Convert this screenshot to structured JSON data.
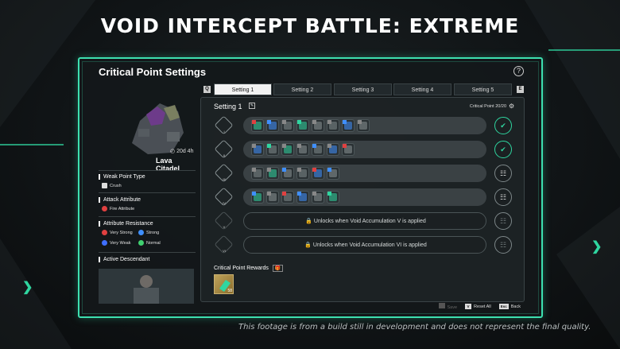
{
  "headline": "VOID INTERCEPT BATTLE: EXTREME",
  "panel": {
    "title": "Critical Point Settings",
    "help": "?"
  },
  "boss": {
    "timer": "20d 4h",
    "name": "Lava Citadel"
  },
  "weak_point": {
    "heading": "Weak Point Type",
    "value": "Crush"
  },
  "attack_attribute": {
    "heading": "Attack Attribute",
    "value": "Fire Attribute"
  },
  "resistance": {
    "heading": "Attribute Resistance",
    "items": [
      {
        "label": "Very Strong",
        "color": "#e04040"
      },
      {
        "label": "Strong",
        "color": "#3f8fff"
      },
      {
        "label": "Very Weak",
        "color": "#3f6fff"
      },
      {
        "label": "Normal",
        "color": "#40d070"
      }
    ]
  },
  "descendant": {
    "heading": "Active Descendant"
  },
  "tabs": {
    "left_key": "Q",
    "right_key": "E",
    "items": [
      "Setting 1",
      "Setting 2",
      "Setting 3",
      "Setting 4",
      "Setting 5"
    ],
    "active_index": 0
  },
  "setting": {
    "title": "Setting 1",
    "critical_point_label": "Critical Point",
    "critical_point_value": "20/20"
  },
  "rows": [
    {
      "num": "I",
      "state": "claimed",
      "slots": 8
    },
    {
      "num": "II",
      "state": "claimed",
      "slots": 7
    },
    {
      "num": "III",
      "state": "gift",
      "slots": 6
    },
    {
      "num": "IV",
      "state": "gift",
      "slots": 6
    },
    {
      "num": "V",
      "state": "locked",
      "lock_text": "Unlocks when Void Accumulation V is applied"
    },
    {
      "num": "VI",
      "state": "locked",
      "lock_text": "Unlocks when Void Accumulation VI is applied"
    }
  ],
  "rewards": {
    "label": "Critical Point Rewards",
    "item_qty": "58"
  },
  "footer": {
    "save_label": "Save",
    "reset_key": "V",
    "reset_label": "Reset All",
    "back_key": "Esc",
    "back_label": "Back"
  },
  "disclaimer": "This footage is from a build still in development and does not represent the final quality.",
  "colors": {
    "accent": "#2fd6a0",
    "panel_bg": "#14181a"
  }
}
